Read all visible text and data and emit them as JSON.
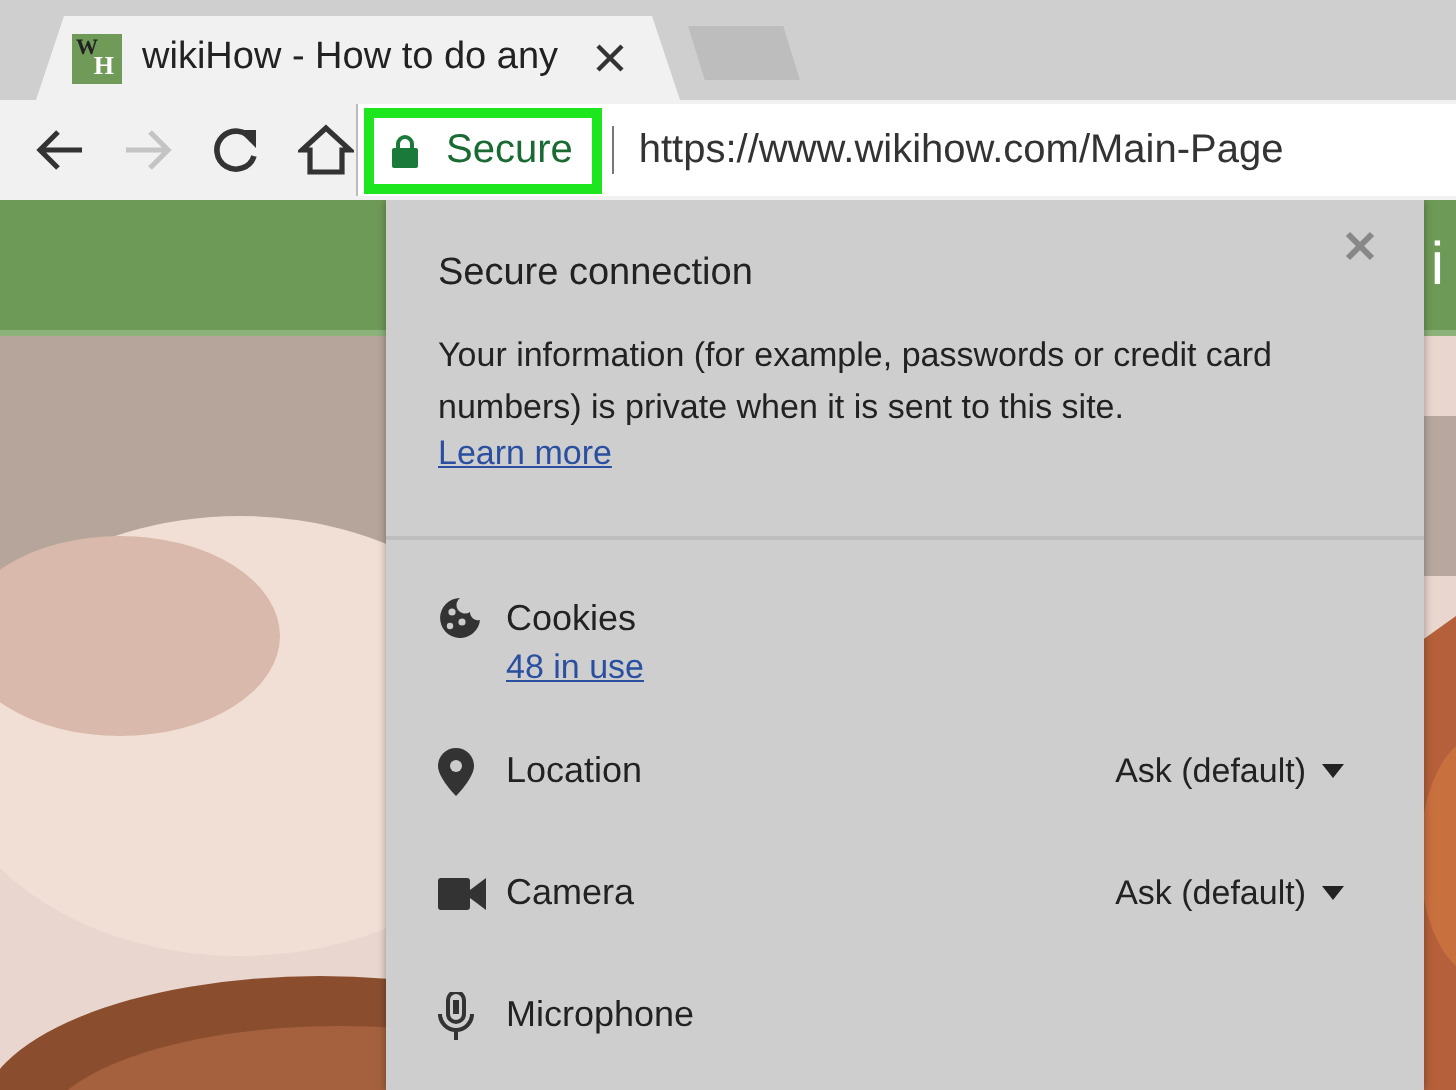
{
  "browser": {
    "tab": {
      "favicon_letters": [
        "W",
        "H"
      ],
      "title": "wikiHow - How to do any",
      "selected": true
    },
    "nav_buttons": [
      {
        "kind": "back",
        "disabled": false
      },
      {
        "kind": "forward",
        "disabled": true
      },
      {
        "kind": "reload",
        "disabled": false
      },
      {
        "kind": "home",
        "disabled": false
      }
    ],
    "url_bar": {
      "security_label": "Secure",
      "highlighted": true,
      "url": "https://www.wikihow.com/Main-Page"
    }
  },
  "page": {
    "header_text": "i"
  },
  "site_info_popup": {
    "title": "Secure connection",
    "description": "Your information (for example, passwords or credit card numbers) is private when it is sent to this site.",
    "link": "Learn more",
    "permissions": [
      {
        "kind": "cookies",
        "name": "Cookies",
        "link": "48 in use"
      },
      {
        "kind": "location",
        "name": "Location",
        "setting": "Ask (default)"
      },
      {
        "kind": "camera",
        "name": "Camera",
        "setting": "Ask (default)"
      },
      {
        "kind": "microphone",
        "name": "Microphone"
      }
    ]
  }
}
